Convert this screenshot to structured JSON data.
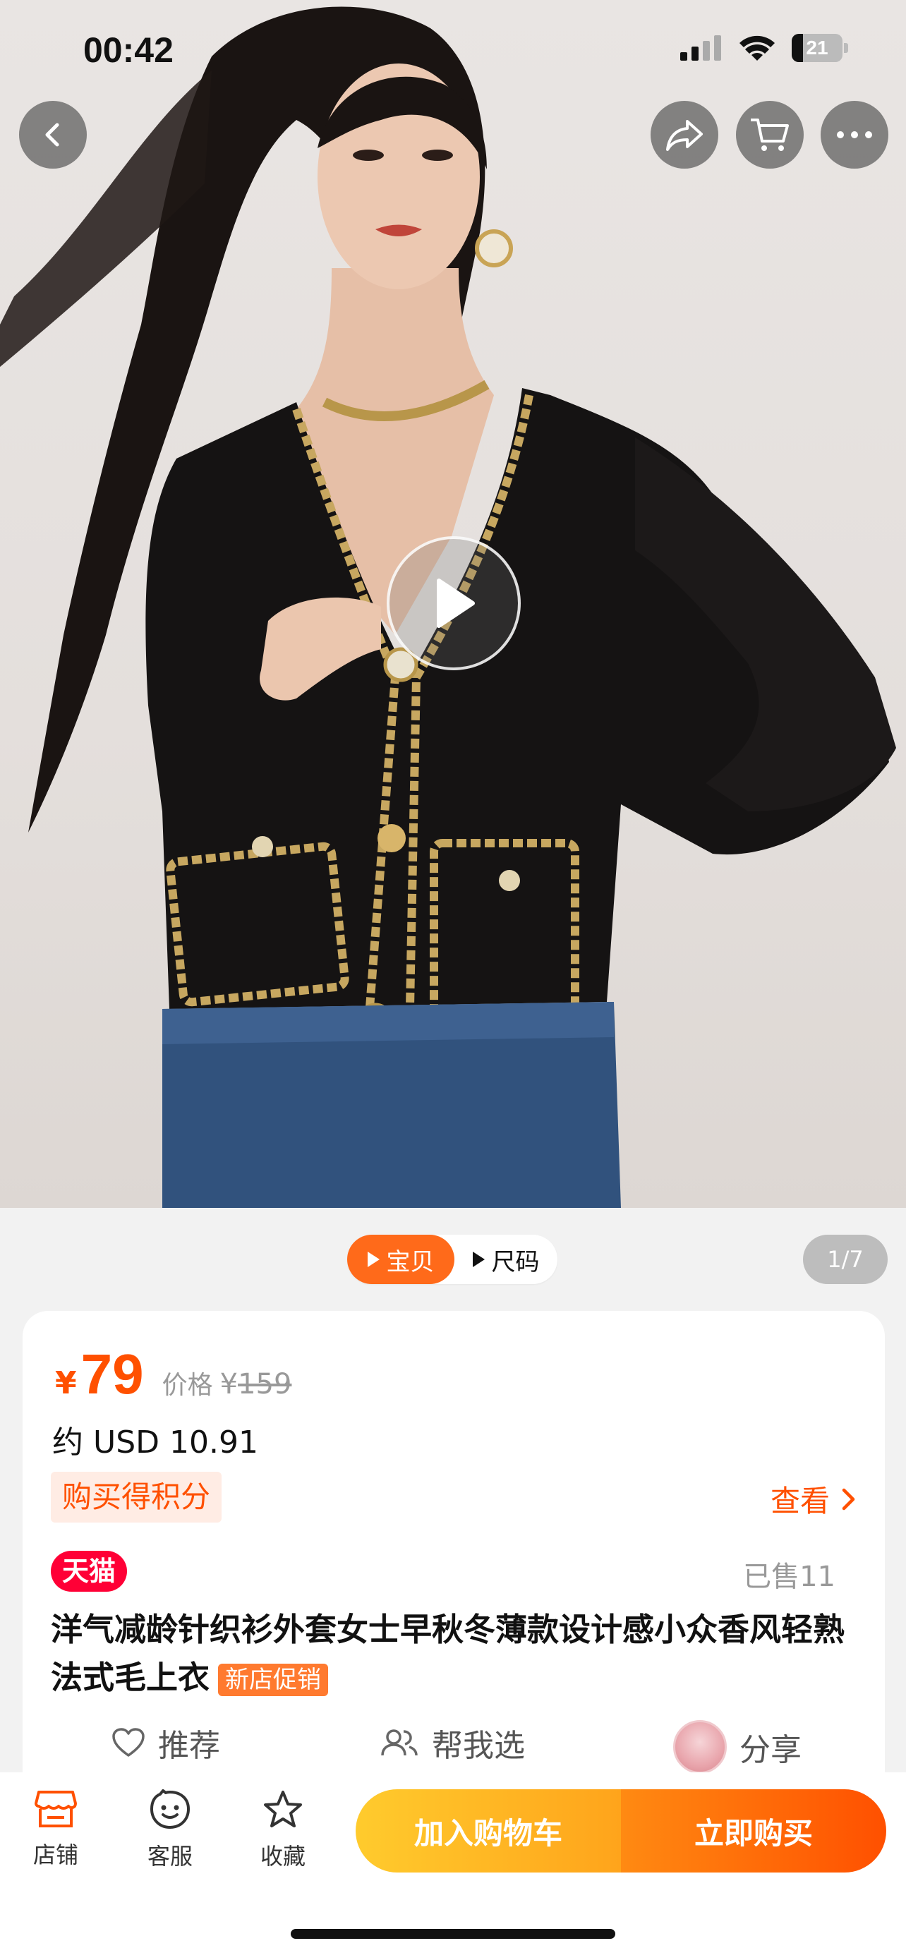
{
  "status_bar": {
    "time": "00:42",
    "battery": "21"
  },
  "top_buttons": [
    "back-icon",
    "share-icon",
    "cart-icon",
    "more-icon"
  ],
  "media": {
    "tabs": [
      {
        "label": "宝贝",
        "active": true
      },
      {
        "label": "尺码",
        "active": false
      }
    ],
    "counter": "1/7"
  },
  "product": {
    "price_currency": "¥",
    "price": "79",
    "original_label": "价格",
    "original_currency": "¥",
    "original_price": "159",
    "usd_price": "约 USD 10.91",
    "points_label": "购买得积分",
    "view_label": "查看",
    "store_badge": "天猫",
    "sold": "已售11",
    "title": "洋气减龄针织衫外套女士早秋冬薄款设计感小众香风轻熟法式毛上衣",
    "promo_tag": "新店促销",
    "actions": [
      {
        "label": "推荐",
        "icon": "heart-icon"
      },
      {
        "label": "帮我选",
        "icon": "users-icon"
      },
      {
        "label": "分享",
        "icon": "avatar-icon"
      }
    ]
  },
  "bottom_bar": {
    "items": [
      {
        "label": "店铺",
        "icon": "store-icon"
      },
      {
        "label": "客服",
        "icon": "service-icon"
      },
      {
        "label": "收藏",
        "icon": "star-icon"
      }
    ],
    "add_to_cart": "加入购物车",
    "buy_now": "立即购买"
  },
  "colors": {
    "accent": "#ff5000",
    "tmall": "#ff0036",
    "cart_btn": "#ffb424"
  }
}
